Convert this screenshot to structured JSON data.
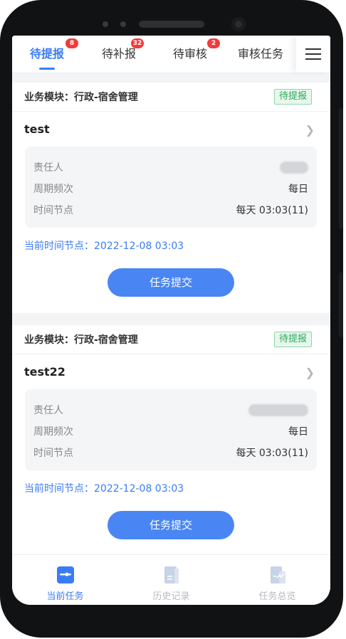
{
  "tabs": [
    {
      "label": "待提报",
      "badge": "8",
      "active": true
    },
    {
      "label": "待补报",
      "badge": "32",
      "active": false
    },
    {
      "label": "待审核",
      "badge": "2",
      "active": false
    },
    {
      "label": "审核任务",
      "badge": "",
      "active": false
    }
  ],
  "menu_icon": "hamburger-menu-icon",
  "cards": [
    {
      "module": "业务模块：行政-宿舍管理",
      "status": "待提报",
      "name": "test",
      "rows": [
        {
          "label": "责任人",
          "value": ""
        },
        {
          "label": "周期频次",
          "value": "每日"
        },
        {
          "label": "时间节点",
          "value": "每天 03:03(11)"
        }
      ],
      "current_time": "当前时间节点：2022-12-08 03:03",
      "button": "任务提交"
    },
    {
      "module": "业务模块：行政-宿舍管理",
      "status": "待提报",
      "name": "test22",
      "rows": [
        {
          "label": "责任人",
          "value": ""
        },
        {
          "label": "周期频次",
          "value": "每日"
        },
        {
          "label": "时间节点",
          "value": "每天 03:03(11)"
        }
      ],
      "current_time": "当前时间节点：2022-12-08 03:03",
      "button": "任务提交"
    }
  ],
  "bottom_nav": [
    {
      "label": "当前任务",
      "icon": "current-task-icon",
      "active": true
    },
    {
      "label": "历史记录",
      "icon": "history-icon",
      "active": false
    },
    {
      "label": "任务总览",
      "icon": "overview-icon",
      "active": false
    }
  ],
  "colors": {
    "accent": "#3a7cf6",
    "badge": "#f33a3a",
    "status_green": "#27a95a",
    "frame": "#111214"
  }
}
